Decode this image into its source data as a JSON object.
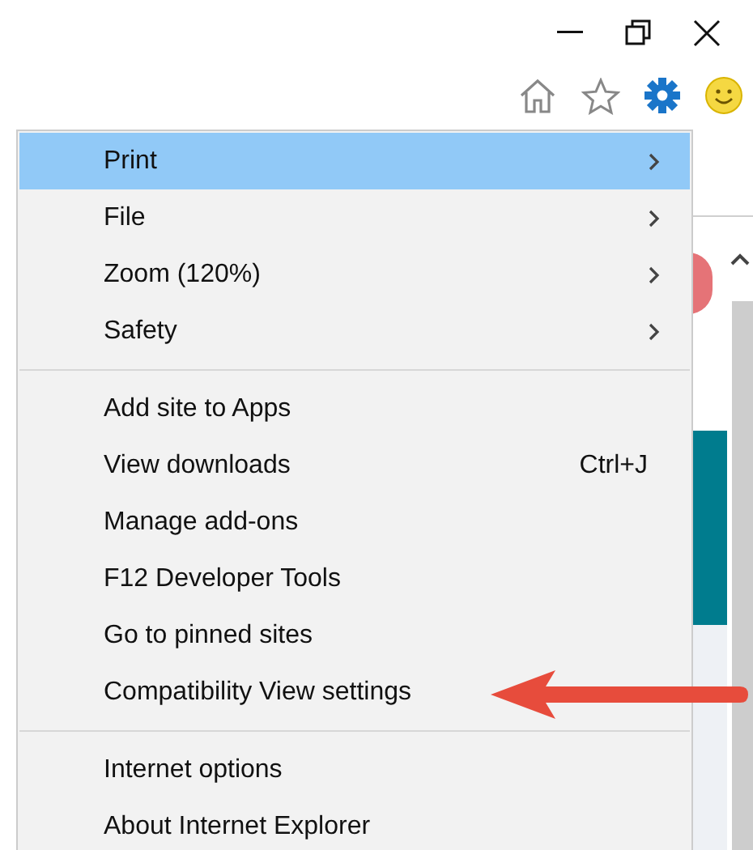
{
  "menu": {
    "groups": [
      [
        {
          "label": "Print",
          "selected": true,
          "submenu": true
        },
        {
          "label": "File",
          "selected": false,
          "submenu": true
        },
        {
          "label": "Zoom (120%)",
          "selected": false,
          "submenu": true
        },
        {
          "label": "Safety",
          "selected": false,
          "submenu": true
        }
      ],
      [
        {
          "label": "Add site to Apps",
          "selected": false,
          "submenu": false
        },
        {
          "label": "View downloads",
          "selected": false,
          "submenu": false,
          "shortcut": "Ctrl+J"
        },
        {
          "label": "Manage add-ons",
          "selected": false,
          "submenu": false
        },
        {
          "label": "F12 Developer Tools",
          "selected": false,
          "submenu": false
        },
        {
          "label": "Go to pinned sites",
          "selected": false,
          "submenu": false
        },
        {
          "label": "Compatibility View settings",
          "selected": false,
          "submenu": false
        }
      ],
      [
        {
          "label": "Internet options",
          "selected": false,
          "submenu": false
        },
        {
          "label": "About Internet Explorer",
          "selected": false,
          "submenu": false
        }
      ]
    ]
  }
}
